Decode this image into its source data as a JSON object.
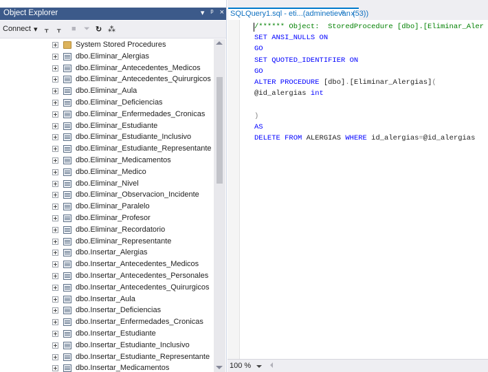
{
  "object_explorer": {
    "title": "Object Explorer",
    "title_buttons": [
      "▾",
      "ᵖ",
      "×"
    ],
    "toolbar": {
      "connect_label": "Connect",
      "connect_arrow": "▾",
      "icon_names": [
        "connect-object-explorer-icon",
        "disconnect-icon",
        "stop-icon",
        "filter-icon",
        "refresh-icon",
        "activity-monitor-icon"
      ],
      "icon_glyphs": [
        "ᚁ",
        "ᚁ",
        "■",
        "⏷",
        "↻",
        "⁂"
      ]
    },
    "tree": {
      "items": [
        {
          "label": "System Stored Procedures",
          "icon": "folder-icon"
        },
        {
          "label": "dbo.Eliminar_Alergias",
          "icon": "stored-procedure-icon"
        },
        {
          "label": "dbo.Eliminar_Antecedentes_Medicos",
          "icon": "stored-procedure-icon"
        },
        {
          "label": "dbo.Eliminar_Antecedentes_Quirurgicos",
          "icon": "stored-procedure-icon"
        },
        {
          "label": "dbo.Eliminar_Aula",
          "icon": "stored-procedure-icon"
        },
        {
          "label": "dbo.Eliminar_Deficiencias",
          "icon": "stored-procedure-icon"
        },
        {
          "label": "dbo.Eliminar_Enfermedades_Cronicas",
          "icon": "stored-procedure-icon"
        },
        {
          "label": "dbo.Eliminar_Estudiante",
          "icon": "stored-procedure-icon"
        },
        {
          "label": "dbo.Eliminar_Estudiante_Inclusivo",
          "icon": "stored-procedure-icon"
        },
        {
          "label": "dbo.Eliminar_Estudiante_Representante",
          "icon": "stored-procedure-icon"
        },
        {
          "label": "dbo.Eliminar_Medicamentos",
          "icon": "stored-procedure-icon"
        },
        {
          "label": "dbo.Eliminar_Medico",
          "icon": "stored-procedure-icon"
        },
        {
          "label": "dbo.Eliminar_Nivel",
          "icon": "stored-procedure-icon"
        },
        {
          "label": "dbo.Eliminar_Observacion_Incidente",
          "icon": "stored-procedure-icon"
        },
        {
          "label": "dbo.Eliminar_Paralelo",
          "icon": "stored-procedure-icon"
        },
        {
          "label": "dbo.Eliminar_Profesor",
          "icon": "stored-procedure-icon"
        },
        {
          "label": "dbo.Eliminar_Recordatorio",
          "icon": "stored-procedure-icon"
        },
        {
          "label": "dbo.Eliminar_Representante",
          "icon": "stored-procedure-icon"
        },
        {
          "label": "dbo.Insertar_Alergias",
          "icon": "stored-procedure-icon"
        },
        {
          "label": "dbo.Insertar_Antecedentes_Medicos",
          "icon": "stored-procedure-icon"
        },
        {
          "label": "dbo.Insertar_Antecedentes_Personales",
          "icon": "stored-procedure-icon"
        },
        {
          "label": "dbo.Insertar_Antecedentes_Quirurgicos",
          "icon": "stored-procedure-icon"
        },
        {
          "label": "dbo.Insertar_Aula",
          "icon": "stored-procedure-icon"
        },
        {
          "label": "dbo.Insertar_Deficiencias",
          "icon": "stored-procedure-icon"
        },
        {
          "label": "dbo.Insertar_Enfermedades_Cronicas",
          "icon": "stored-procedure-icon"
        },
        {
          "label": "dbo.Insertar_Estudiante",
          "icon": "stored-procedure-icon"
        },
        {
          "label": "dbo.Insertar_Estudiante_Inclusivo",
          "icon": "stored-procedure-icon"
        },
        {
          "label": "dbo.Insertar_Estudiante_Representante",
          "icon": "stored-procedure-icon"
        },
        {
          "label": "dbo.Insertar_Medicamentos",
          "icon": "stored-procedure-icon"
        }
      ]
    }
  },
  "editor": {
    "tab": {
      "title": "SQLQuery1.sql - eti...(adminetievan (53))",
      "pin": "ᵖ",
      "close": "×"
    },
    "code_lines": [
      [
        {
          "t": "/****** Object:  StoredProcedure [dbo].[Eliminar_Aler",
          "c": "cm"
        }
      ],
      [
        {
          "t": "SET ANSI_NULLS ON",
          "c": "kw"
        }
      ],
      [
        {
          "t": "GO",
          "c": "kw"
        }
      ],
      [
        {
          "t": "SET QUOTED_IDENTIFIER ON",
          "c": "kw"
        }
      ],
      [
        {
          "t": "GO",
          "c": "kw"
        }
      ],
      [
        {
          "t": "ALTER PROCEDURE ",
          "c": "kw"
        },
        {
          "t": "[dbo]",
          "c": "id"
        },
        {
          "t": ".",
          "c": "op"
        },
        {
          "t": "[Eliminar_Alergias]",
          "c": "id"
        },
        {
          "t": "(",
          "c": "op"
        }
      ],
      [
        {
          "t": "@id_alergias ",
          "c": "id"
        },
        {
          "t": "int",
          "c": "kw"
        }
      ],
      [],
      [
        {
          "t": ")",
          "c": "op"
        }
      ],
      [
        {
          "t": "AS",
          "c": "kw"
        }
      ],
      [
        {
          "t": "DELETE FROM ",
          "c": "kw"
        },
        {
          "t": "ALERGIAS ",
          "c": "id"
        },
        {
          "t": "WHERE ",
          "c": "kw"
        },
        {
          "t": "id_alergias",
          "c": "id"
        },
        {
          "t": "=",
          "c": "op"
        },
        {
          "t": "@id_alergias",
          "c": "id"
        }
      ]
    ],
    "zoom": "100 %",
    "colors": {
      "keyword": "#0000ff",
      "comment": "#008000",
      "identifier": "#1e1e1e",
      "operator": "#808080",
      "title_bar": "#3c5a8a",
      "tab_accent": "#007acc"
    }
  }
}
